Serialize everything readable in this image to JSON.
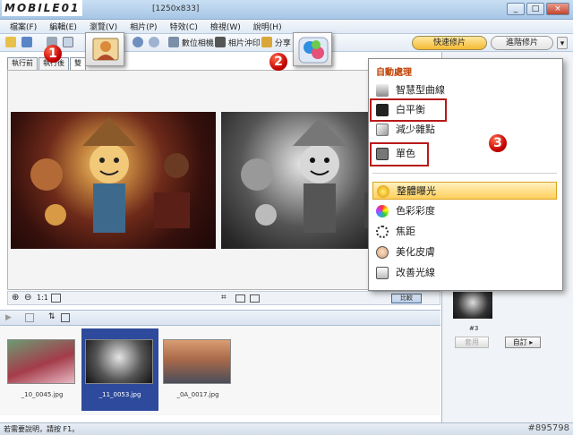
{
  "watermark": "MOBILE01",
  "window": {
    "title": "[1250x833]",
    "buttons": [
      "_",
      "□",
      "×"
    ]
  },
  "menu_bar": [
    "檔案(F)",
    "編輯(E)",
    "瀏覽(V)",
    "相片(P)",
    "特效(C)",
    "檢視(W)",
    "說明(H)"
  ],
  "toolbar": {
    "digital_album": "數位相機",
    "print_order": "相片沖印",
    "share": "分享",
    "tab_quick_edit": "快速修片",
    "tab_advanced_edit": "進階修片",
    "more": "▾"
  },
  "editor_tabs": [
    "執行前",
    "執行後",
    "雙"
  ],
  "zoom_controls": {
    "actual_size": "1:1"
  },
  "viewer_footer": {
    "compare": "比較"
  },
  "filmstrip": {
    "items": [
      {
        "caption": "_10_0045.jpg",
        "selected": false
      },
      {
        "caption": "_11_0053.jpg",
        "selected": true
      },
      {
        "caption": "_0A_0017.jpg",
        "selected": false
      }
    ]
  },
  "right_panel": {
    "sample_label": "#3",
    "apply_button": "套用",
    "custom_button": "自訂 ▸"
  },
  "status_bar": {
    "hint": "若需要說明，請按 F1。",
    "id": "#895798"
  },
  "auto_menu": {
    "header": "自動處理",
    "items_a": [
      "智慧型曲線",
      "白平衡",
      "減少雜點",
      "單色"
    ],
    "items_b": [
      "整體曝光",
      "色彩彩度",
      "焦距",
      "美化皮膚",
      "改善光線"
    ],
    "highlighted": "整體曝光"
  },
  "callouts": [
    "1",
    "2",
    "3"
  ],
  "colors": {
    "highlight": "#ffcf5c",
    "callout": "#c20000",
    "redbox": "#b81a1a",
    "selected_thumb": "#2e4a9c"
  }
}
